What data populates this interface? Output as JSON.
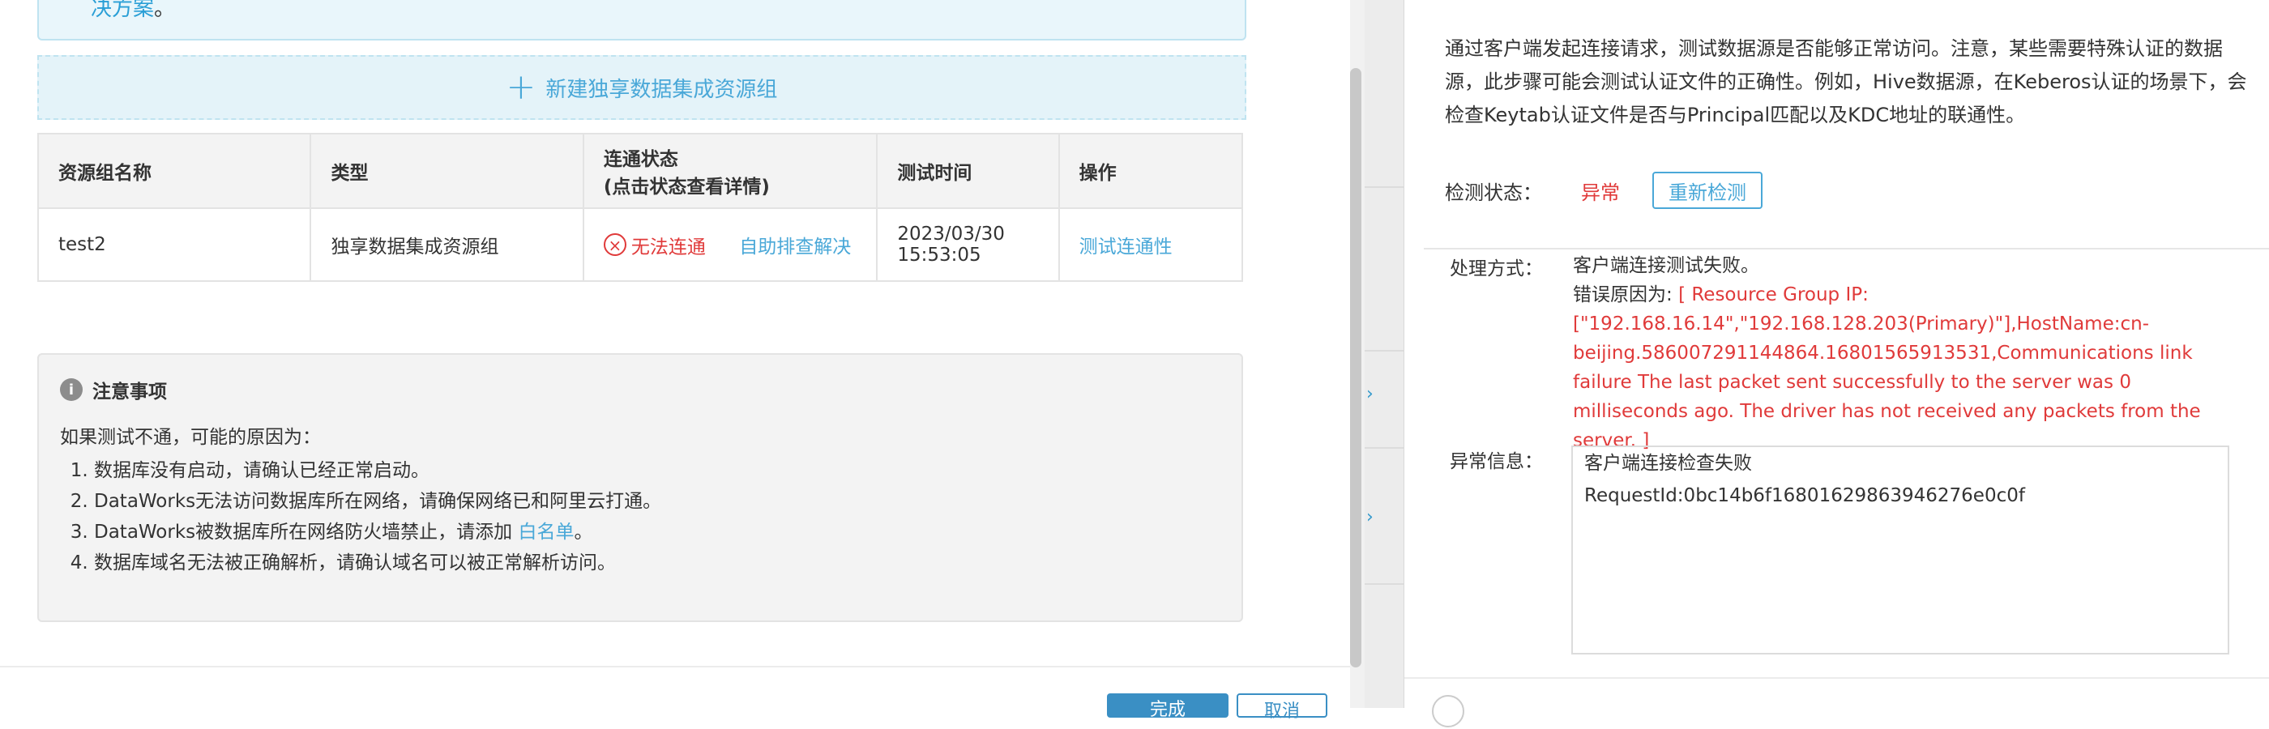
{
  "top_alert": {
    "link_text": "决方案",
    "suffix": "。"
  },
  "new_group_button": {
    "plus": "+",
    "label": "新建独享数据集成资源组"
  },
  "table": {
    "headers": [
      "资源组名称",
      "类型",
      "连通状态",
      "(点击状态查看详情)",
      "测试时间",
      "操作"
    ],
    "rows": [
      {
        "name": "test2",
        "type": "独享数据集成资源组",
        "status_icon": "×",
        "status": "无法连通",
        "self_fix": "自助排查解决",
        "test_time_date": "2023/03/30",
        "test_time_clock": "15:53:05",
        "action": "测试连通性"
      }
    ]
  },
  "notes": {
    "info_icon": "i",
    "title": "注意事项",
    "intro": "如果测试不通，可能的原因为：",
    "items": [
      "数据库没有启动，请确认已经正常启动。",
      "DataWorks无法访问数据库所在网络，请确保网络已和阿里云打通。",
      "DataWorks被数据库所在网络防火墙禁止，请添加",
      "数据库域名无法被正确解析，请确认域名可以被正常解析访问。"
    ],
    "whitelist_link": "白名单",
    "whitelist_suffix": "。"
  },
  "footer": {
    "confirm_label": "完成",
    "cancel_label": "取消"
  },
  "side_strip": {
    "marks": [
      "›",
      "›"
    ]
  },
  "right_panel": {
    "description": "通过客户端发起连接请求，测试数据源是否能够正常访问。注意，某些需要特殊认证的数据源，此步骤可能会测试认证文件的正确性。例如，Hive数据源，在Keberos认证的场景下，会检查Keytab认证文件是否与Principal匹配以及KDC地址的联通性。",
    "check_status_label": "检测状态：",
    "check_status_value": "异常",
    "recheck_label": "重新检测",
    "method_label": "处理方式：",
    "method_line1": "客户端连接测试失败。",
    "error_reason_label": "错误原因为:",
    "error_reason_text": "[ Resource Group IP: [\"192.168.16.14\",\"192.168.128.203(Primary)\"],HostName:cn-beijing.586007291144864.16801565913531,Communications link failure The last packet sent successfully to the server was 0 milliseconds ago. The driver has not received any packets from the server. ]",
    "exception_label": "异常信息：",
    "exception_line1": "客户端连接检查失败",
    "exception_line2": "RequestId:0bc14b6f16801629863946276e0c0f"
  },
  "colors": {
    "accent": "#4aa8d8",
    "error": "#e03a3a",
    "primary_button": "#3a8fc4"
  }
}
